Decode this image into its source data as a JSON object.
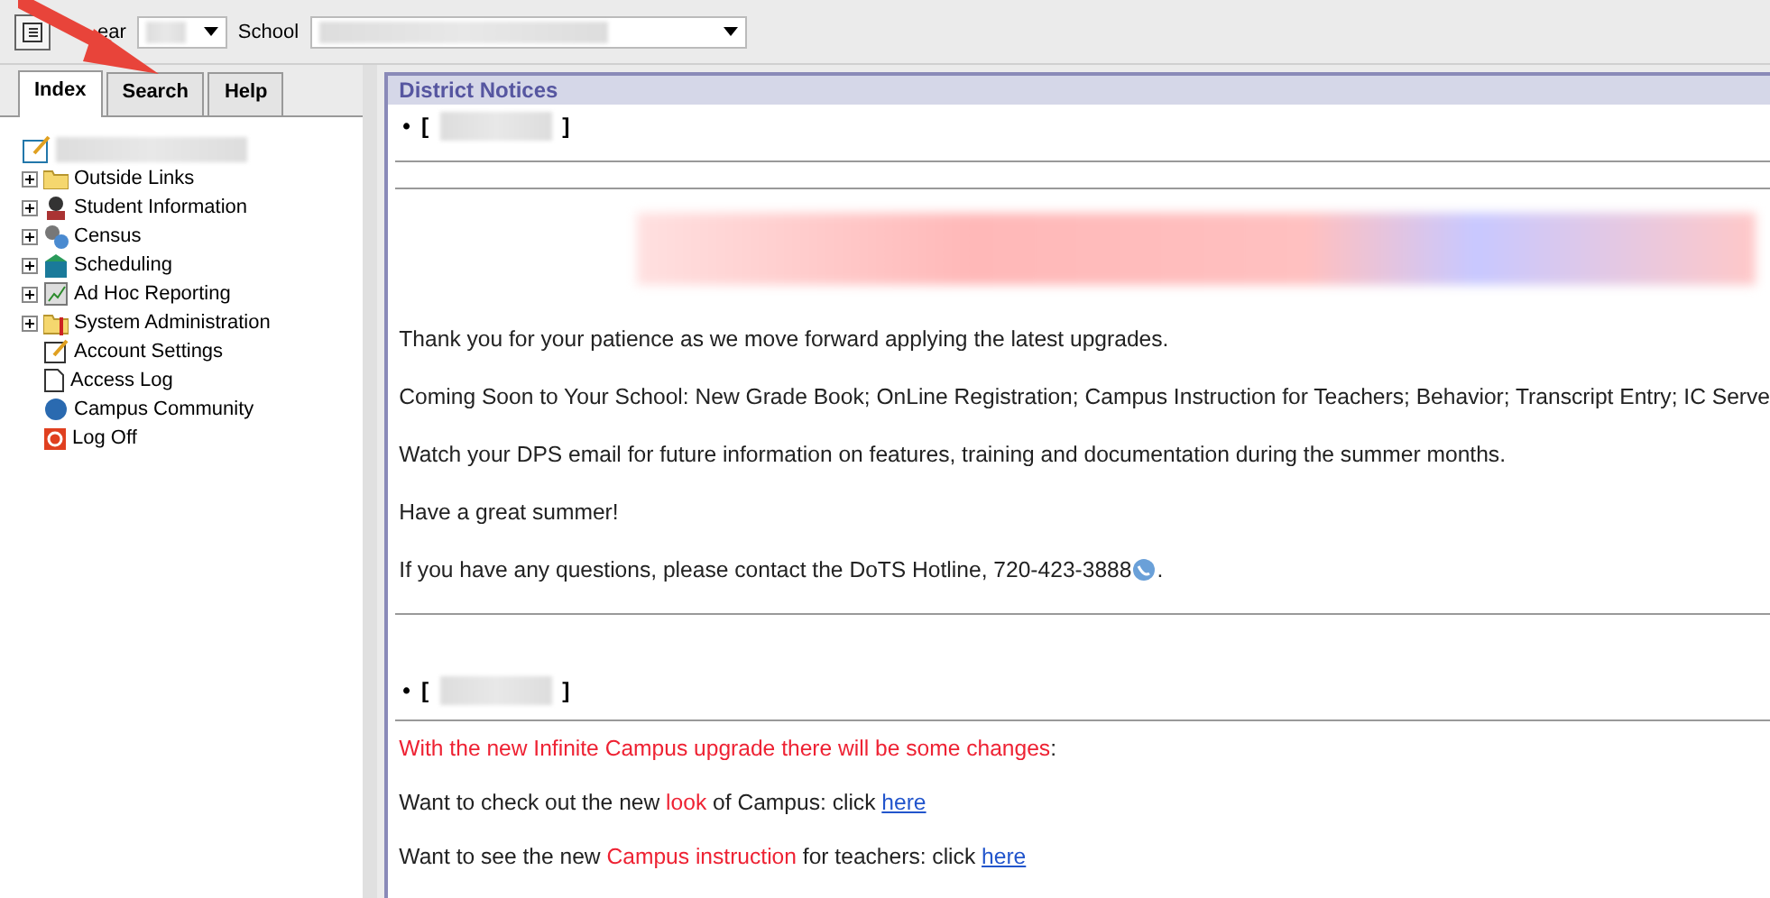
{
  "toolbar": {
    "year_label": "ear",
    "school_label": "School"
  },
  "tabs": [
    {
      "label": "Index",
      "selected": true
    },
    {
      "label": "Search",
      "selected": false
    },
    {
      "label": "Help",
      "selected": false
    }
  ],
  "tree": [
    {
      "label": "Outside Links",
      "kind": "folder",
      "expandable": true
    },
    {
      "label": "Student Information",
      "kind": "student",
      "expandable": true
    },
    {
      "label": "Census",
      "kind": "census",
      "expandable": true
    },
    {
      "label": "Scheduling",
      "kind": "scheduling",
      "expandable": true
    },
    {
      "label": "Ad Hoc Reporting",
      "kind": "report",
      "expandable": true
    },
    {
      "label": "System Administration",
      "kind": "admin",
      "expandable": true
    },
    {
      "label": "Account Settings",
      "kind": "settings",
      "expandable": false
    },
    {
      "label": "Access Log",
      "kind": "page",
      "expandable": false
    },
    {
      "label": "Campus Community",
      "kind": "community",
      "expandable": false
    },
    {
      "label": "Log Off",
      "kind": "logoff",
      "expandable": false
    }
  ],
  "notices": {
    "title": "District Notices",
    "first_paragraphs": [
      "Thank you for your patience as we move forward applying the latest upgrades.",
      "Coming Soon to Your School: New Grade Book; OnLine Registration; Campus Instruction for Teachers; Behavior; Transcript Entry; IC Serve",
      "Watch your DPS email for future information on features, training and documentation during the summer months.",
      "Have a great summer!",
      "If you have any questions, please contact the DoTS Hotline, 720-423-3888"
    ],
    "closing_mark": ".",
    "entries": [
      {
        "bullet": "•",
        "open": "[",
        "close": "]"
      },
      {
        "bullet": "•",
        "open": "[",
        "close": "]"
      }
    ],
    "second_paragraphs": [
      [
        {
          "kind": "red",
          "text": "With the new Infinite Campus upgrade there will be some changes"
        },
        {
          "kind": "plain",
          "text": ":"
        }
      ],
      [
        {
          "kind": "plain",
          "text": "Want to check out the new "
        },
        {
          "kind": "red",
          "text": "look"
        },
        {
          "kind": "plain",
          "text": " of Campus: click "
        },
        {
          "kind": "link",
          "text": "here"
        }
      ],
      [
        {
          "kind": "plain",
          "text": "Want to see the new "
        },
        {
          "kind": "red",
          "text": "Campus instruction"
        },
        {
          "kind": "plain",
          "text": " for teachers: click "
        },
        {
          "kind": "link",
          "text": "here"
        }
      ]
    ]
  }
}
